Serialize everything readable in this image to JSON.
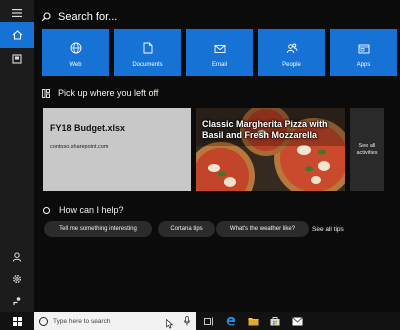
{
  "search": {
    "label": "Search for..."
  },
  "tiles": [
    {
      "label": "Web",
      "icon": "globe-icon"
    },
    {
      "label": "Documents",
      "icon": "document-icon"
    },
    {
      "label": "Email",
      "icon": "mail-icon"
    },
    {
      "label": "People",
      "icon": "people-icon"
    },
    {
      "label": "Apps",
      "icon": "apps-icon"
    }
  ],
  "pickup": {
    "title": "Pick up where you left off",
    "doc_title": "FY18 Budget.xlsx",
    "doc_source": "contoso.sharepoint.com",
    "pizza_title": "Classic Margherita Pizza with Basil and Fresh Mozzarella",
    "see_all_line1": "See all",
    "see_all_line2": "activities"
  },
  "help": {
    "title": "How can I help?",
    "chips": [
      "Tell me something interesting",
      "Cortana tips",
      "What's the weather like?"
    ],
    "see_all": "See all tips"
  },
  "taskbar": {
    "search_placeholder": "Type here to search"
  },
  "colors": {
    "accent": "#1672d4",
    "background": "#0b0b0b",
    "rail": "#1c1c1c"
  }
}
